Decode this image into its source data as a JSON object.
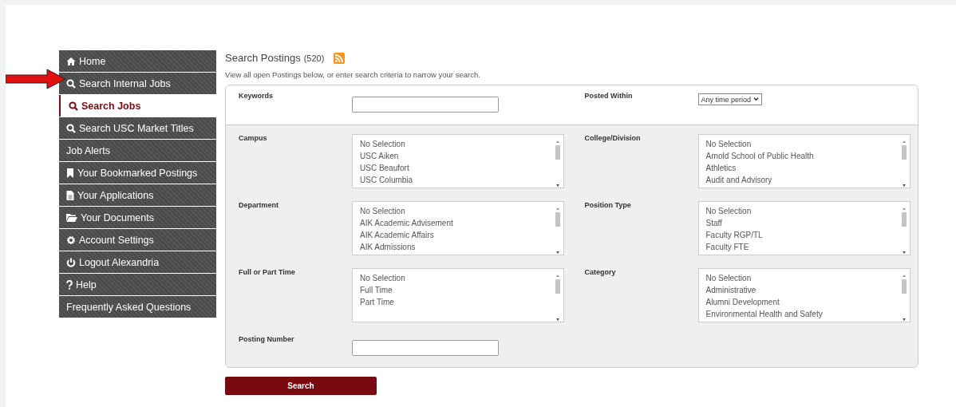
{
  "sidebar": {
    "items": [
      {
        "label": "Home",
        "kind": "home",
        "selected": false
      },
      {
        "label": "Search Internal Jobs",
        "kind": "search",
        "selected": false
      },
      {
        "label": "Search Jobs",
        "kind": "search",
        "selected": true
      },
      {
        "label": "Search USC Market Titles",
        "kind": "search",
        "selected": false
      },
      {
        "label": "Job Alerts",
        "kind": "none",
        "selected": false
      },
      {
        "label": "Your Bookmarked Postings",
        "kind": "bookmark",
        "selected": false
      },
      {
        "label": "Your Applications",
        "kind": "document",
        "selected": false
      },
      {
        "label": "Your Documents",
        "kind": "folder",
        "selected": false
      },
      {
        "label": "Account Settings",
        "kind": "gear",
        "selected": false
      },
      {
        "label": "Logout Alexandria",
        "kind": "power",
        "selected": false
      },
      {
        "label": "Help",
        "kind": "question",
        "selected": false
      },
      {
        "label": "Frequently Asked Questions",
        "kind": "none",
        "selected": false
      }
    ]
  },
  "heading": {
    "title": "Search Postings",
    "count": "(520)"
  },
  "intro": "View all open Postings below, or enter search criteria to narrow your search.",
  "keywords": {
    "label": "Keywords"
  },
  "posted_within": {
    "label": "Posted Within",
    "value": "Any time period"
  },
  "list_fields": [
    {
      "label": "Campus",
      "options": [
        "No Selection",
        "USC Aiken",
        "USC Beaufort",
        "USC Columbia"
      ]
    },
    {
      "label": "College/Division",
      "options": [
        "No Selection",
        "Arnold School of Public Health",
        "Athletics",
        "Audit and Advisory"
      ]
    },
    {
      "label": "Department",
      "options": [
        "No Selection",
        "AIK Academic Advisement",
        "AIK Academic Affairs",
        "AIK Admissions"
      ]
    },
    {
      "label": "Position Type",
      "options": [
        "No Selection",
        "Staff",
        "Faculty RGP/TL",
        "Faculty FTE"
      ]
    },
    {
      "label": "Full or Part Time",
      "options": [
        "No Selection",
        "Full Time",
        "Part Time"
      ]
    },
    {
      "label": "Category",
      "options": [
        "No Selection",
        "Administrative",
        "Alumni Development",
        "Environmental Health and Safety"
      ]
    }
  ],
  "bottom_field": {
    "label": "Posting Number"
  },
  "search_button": "Search"
}
